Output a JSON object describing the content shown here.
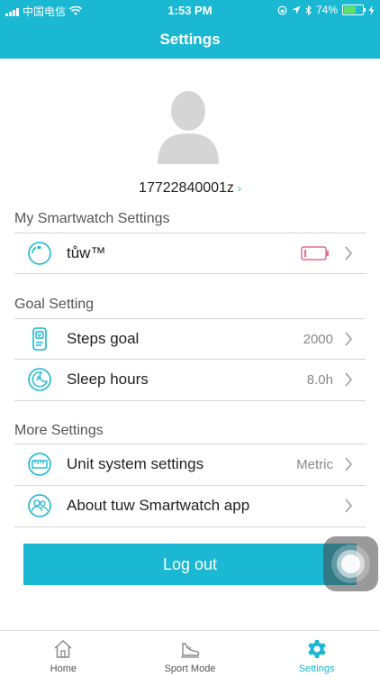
{
  "status_bar": {
    "carrier": "中国电信",
    "time": "1:53 PM",
    "battery_text": "74%",
    "battery_level": 0.74
  },
  "header": {
    "title": "Settings"
  },
  "profile": {
    "username": "17722840001z"
  },
  "sections": {
    "smartwatch": {
      "title": "My Smartwatch Settings",
      "device_name": "tůw™",
      "battery_status": "low",
      "battery_color": "#e86c8c"
    },
    "goal": {
      "title": "Goal Setting",
      "steps_label": "Steps goal",
      "steps_value": "2000",
      "sleep_label": "Sleep hours",
      "sleep_value": "8.0h"
    },
    "more": {
      "title": "More Settings",
      "unit_label": "Unit system settings",
      "unit_value": "Metric",
      "about_label": "About tuw Smartwatch app"
    }
  },
  "logout_label": "Log out",
  "tabs": [
    {
      "label": "Home",
      "icon": "home-icon"
    },
    {
      "label": "Sport Mode",
      "icon": "sneaker-icon"
    },
    {
      "label": "Settings",
      "icon": "gear-icon",
      "active": true
    }
  ],
  "colors": {
    "accent": "#1ab8d2",
    "divider": "#d6d6d6"
  }
}
